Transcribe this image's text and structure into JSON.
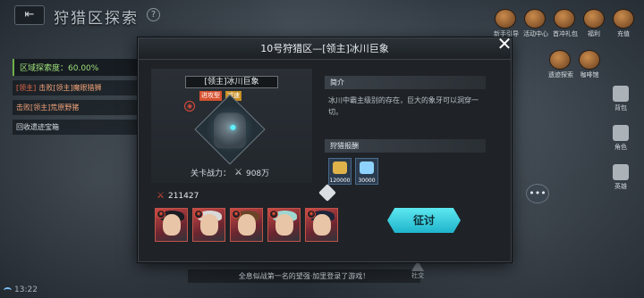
{
  "background": {
    "title": "狩猎区探索",
    "explore_label": "区域探索度：",
    "explore_value": "60.00%",
    "tasks": [
      {
        "tag": "[领主]",
        "text": "击败[领主]魔眼猎狮",
        "color": "orange"
      },
      {
        "tag": "",
        "text": "击败[领主]荒原野猪",
        "color": "orange"
      },
      {
        "tag": "",
        "text": "回收遗迹宝箱",
        "color": "white"
      }
    ],
    "top_icons": [
      {
        "label": "新手引导"
      },
      {
        "label": "活动中心"
      },
      {
        "label": "首冲礼包"
      },
      {
        "label": "福利"
      },
      {
        "label": "充值"
      }
    ],
    "side_menu": [
      {
        "label": "背包"
      },
      {
        "label": "角色"
      },
      {
        "label": "英雄"
      }
    ],
    "other_icons": [
      {
        "label": "遗迹探索"
      },
      {
        "label": "咖啡馆"
      }
    ],
    "scroll_message": "全息似战第一名的望强·加里登录了游戏！",
    "status_time": "13:22",
    "social_label": "社交"
  },
  "modal": {
    "title": "10号狩猎区—[领主]冰川巨象",
    "close_symbol": "✕",
    "boss": {
      "name": "[领主]冰川巨象",
      "tags": [
        "进攻型",
        "减速"
      ],
      "power_label": "关卡战力：",
      "power_value": "908万"
    },
    "intro": {
      "heading": "简介",
      "text": "冰川中霸主级别的存在，巨大的象牙可以洞穿一切。"
    },
    "rewards": {
      "heading": "狩猎报酬",
      "items": [
        {
          "qty": "120000",
          "icon": "gold-coin-icon",
          "color": "#e0b24a"
        },
        {
          "qty": "30000",
          "icon": "crystal-icon",
          "color": "#8ed3ff"
        }
      ]
    },
    "team_power": "211427",
    "attack_label": "征讨",
    "heroes": [
      {
        "hair": "#1b1b22"
      },
      {
        "hair": "#d8d8d8"
      },
      {
        "hair": "#6b4428"
      },
      {
        "hair": "#9ed7d2"
      },
      {
        "hair": "#1f2438"
      }
    ]
  }
}
